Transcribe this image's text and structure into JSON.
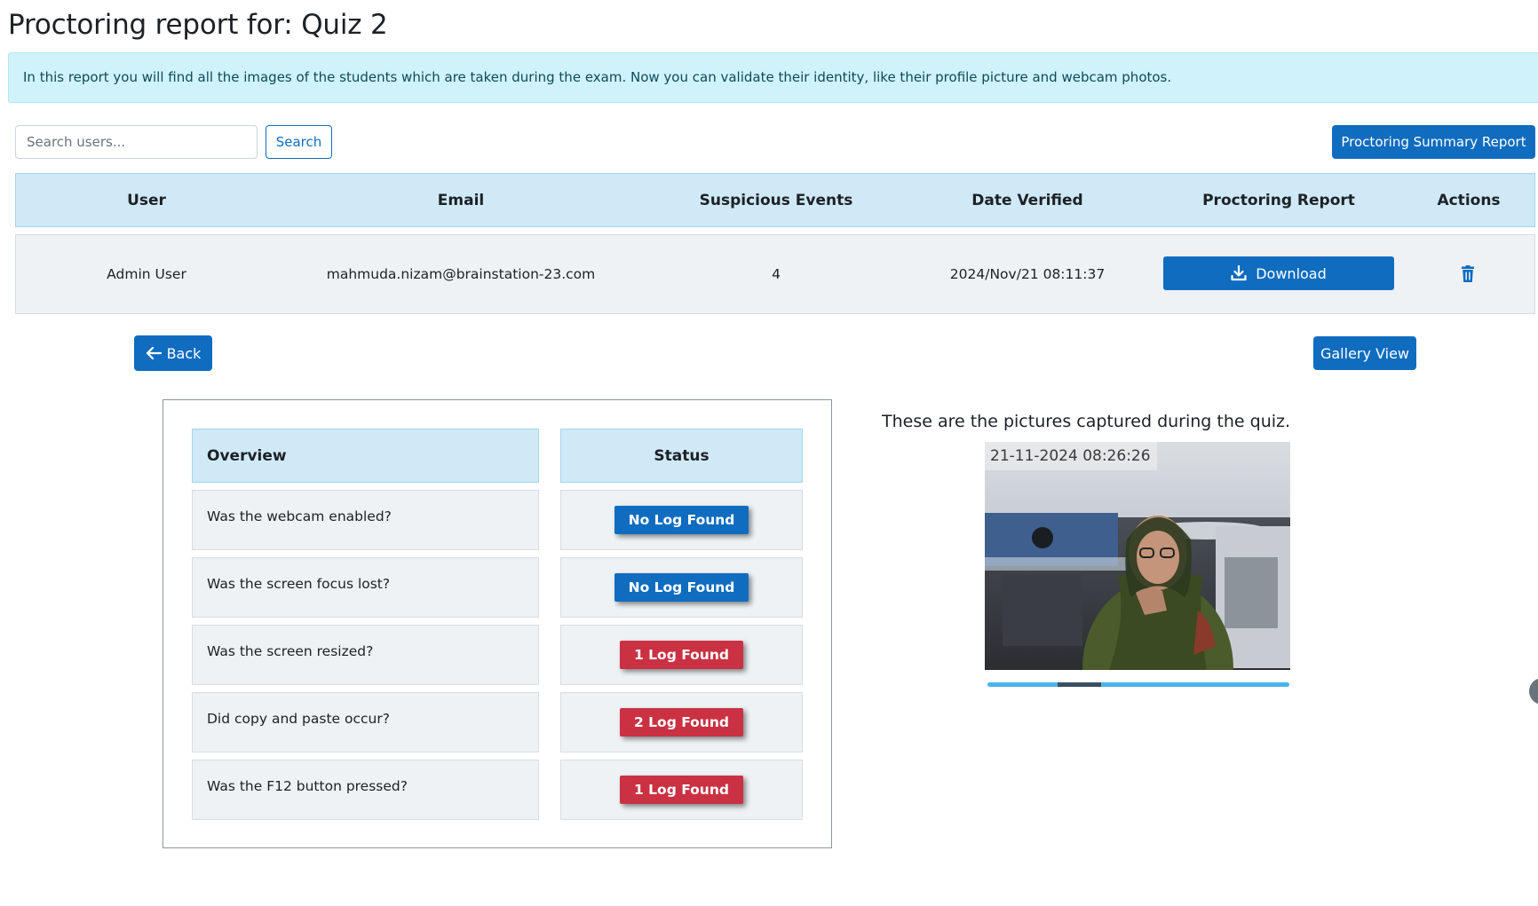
{
  "page": {
    "title": "Proctoring report for: Quiz 2",
    "info_text": "In this report you will find all the images of the students which are taken during the exam. Now you can validate their identity, like their profile picture and webcam photos."
  },
  "search": {
    "placeholder": "Search users...",
    "button_label": "Search"
  },
  "summary_button_label": "Proctoring Summary Report",
  "table": {
    "headers": {
      "user": "User",
      "email": "Email",
      "suspicious": "Suspicious Events",
      "date": "Date Verified",
      "report": "Proctoring Report",
      "actions": "Actions"
    },
    "row": {
      "user": "Admin User",
      "email": "mahmuda.nizam@brainstation-23.com",
      "suspicious": "4",
      "date": "2024/Nov/21 08:11:37",
      "report_button": "Download",
      "action_icon": "trash-icon"
    }
  },
  "nav": {
    "back_label": "Back",
    "gallery_label": "Gallery View"
  },
  "overview": {
    "header": "Overview",
    "status_header": "Status",
    "items": [
      {
        "question": "Was the webcam enabled?",
        "status": "No Log Found",
        "status_color": "#0f6cbf"
      },
      {
        "question": "Was the screen focus lost?",
        "status": "No Log Found",
        "status_color": "#0f6cbf"
      },
      {
        "question": "Was the screen resized?",
        "status": "1 Log Found",
        "status_color": "#ca3143"
      },
      {
        "question": "Did copy and paste occur?",
        "status": "2 Log Found",
        "status_color": "#ca3143"
      },
      {
        "question": "Was the F12 button pressed?",
        "status": "1 Log Found",
        "status_color": "#ca3143"
      }
    ]
  },
  "captures": {
    "title": "These are the pictures captured during the quiz.",
    "photo_timestamp": "21-11-2024 08:26:26",
    "slider_position": 0.27
  },
  "colors": {
    "primary": "#0f6cbf",
    "danger": "#ca3143",
    "table_header_bg": "#cfe9f7",
    "info_bg": "#d0f3fb"
  }
}
